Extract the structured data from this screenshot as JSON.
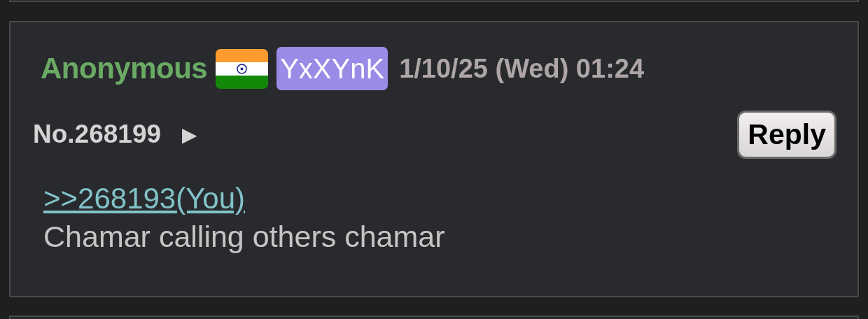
{
  "post": {
    "name": "Anonymous",
    "flag": {
      "kind": "india"
    },
    "poster_id": {
      "label": "YxXYnK",
      "color": "#9b8ae6"
    },
    "date": "1/10/25 (Wed) 01:24",
    "number": "No.268199",
    "menu_arrow": "▶",
    "reply_button": "Reply",
    "body": [
      {
        "kind": "quote",
        "text": ">>268193",
        "you": "(You)"
      },
      {
        "kind": "text",
        "text": "Chamar calling others chamar"
      }
    ]
  }
}
